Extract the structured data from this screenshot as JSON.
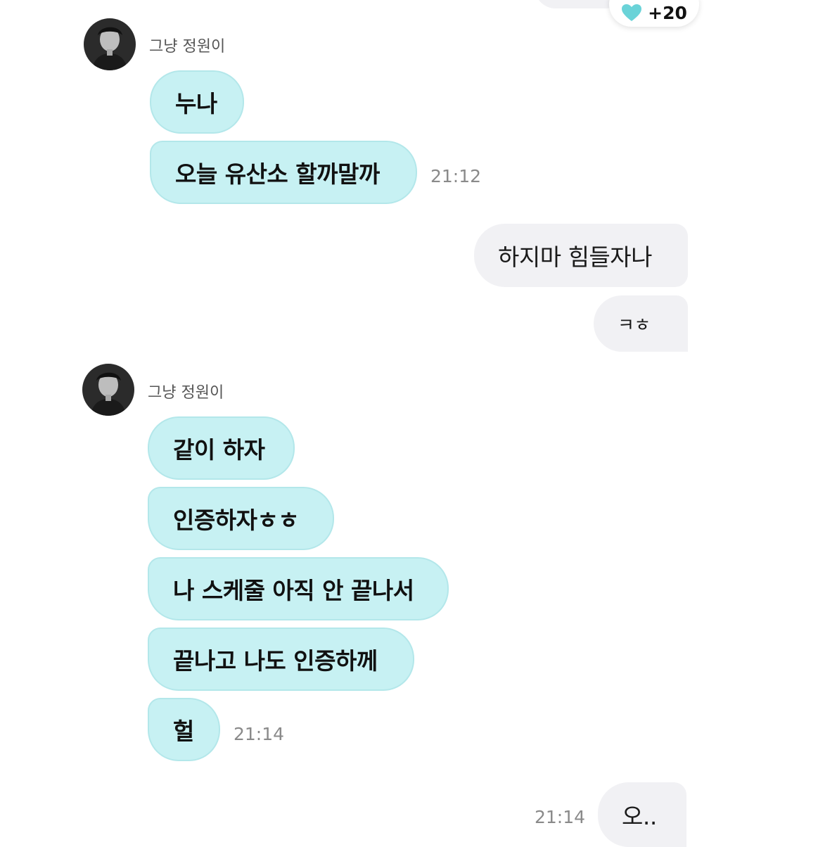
{
  "reaction": {
    "icon": "heart-icon",
    "color": "#6ad3d8",
    "count": "+20"
  },
  "groups": [
    {
      "sender": "그냥 정원이",
      "messages": [
        "누나",
        "오늘 유산소 할까말까"
      ],
      "time": "21:12"
    },
    {
      "sender": "그냥 정원이",
      "messages": [
        "같이 하자",
        "인증하자ㅎㅎ",
        "나 스케줄 아직 안 끝나서",
        "끝나고 나도 인증하께",
        "헐"
      ],
      "time": "21:14"
    }
  ],
  "my_messages": {
    "first": [
      "하지마 힘들자나",
      "ㅋㅎ"
    ],
    "last": "오..",
    "last_time": "21:14"
  },
  "colors": {
    "incoming_bubble": "#c7f1f3",
    "outgoing_bubble": "#f1f1f4",
    "timestamp": "#8a8a8a"
  }
}
